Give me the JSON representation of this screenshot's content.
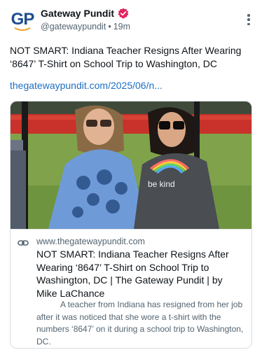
{
  "post": {
    "author_name": "Gateway Pundit",
    "author_handle": "@gatewaypundit",
    "separator": "•",
    "time_ago": "19m",
    "avatar_text": "GP",
    "text": "NOT SMART: Indiana Teacher Resigns After Wearing ‘8647’ T-Shirt on School Trip to Washington, DC",
    "link_text": "thegatewaypundit.com/2025/06/n..."
  },
  "card": {
    "domain": "www.thegatewaypundit.com",
    "title": "NOT SMART: Indiana Teacher Resigns After Wearing ‘8647’ T-Shirt on School Trip to Washington, DC | The Gateway Pundit | by Mike LaChance",
    "description": "A teacher from Indiana has resigned from her job after it was noticed that she wore a t-shirt with the numbers ‘8647’ on it during a school trip to Washington, DC.",
    "image_shirt_text": "be kind"
  },
  "icons": {
    "verified": "verified-badge-icon",
    "menu": "more-vertical-icon",
    "link": "link-icon"
  },
  "colors": {
    "link": "#1d6fc4",
    "verified_badge": "#e0245e",
    "brand_blue": "#1d4e8f",
    "brand_orange": "#f0a020"
  }
}
